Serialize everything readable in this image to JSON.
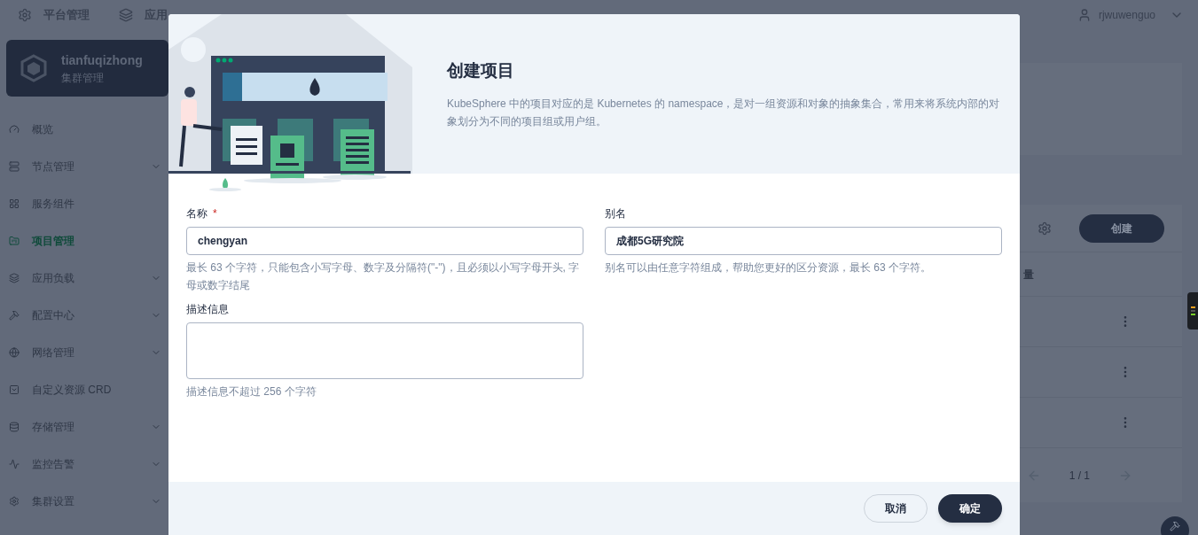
{
  "top_nav": {
    "items": [
      {
        "label": "平台管理"
      },
      {
        "label": "应用"
      }
    ],
    "user": "rjwuwenguo"
  },
  "cluster": {
    "name": "tianfuqizhong",
    "subtitle": "集群管理"
  },
  "sidebar": {
    "items": [
      {
        "label": "概览",
        "expandable": false,
        "selected": false
      },
      {
        "label": "节点管理",
        "expandable": true,
        "selected": false
      },
      {
        "label": "服务组件",
        "expandable": false,
        "selected": false
      },
      {
        "label": "项目管理",
        "expandable": false,
        "selected": true
      },
      {
        "label": "应用负载",
        "expandable": true,
        "selected": false
      },
      {
        "label": "配置中心",
        "expandable": true,
        "selected": false
      },
      {
        "label": "网络管理",
        "expandable": true,
        "selected": false
      },
      {
        "label": "自定义资源 CRD",
        "expandable": false,
        "selected": false
      },
      {
        "label": "存储管理",
        "expandable": true,
        "selected": false
      },
      {
        "label": "监控告警",
        "expandable": true,
        "selected": false
      },
      {
        "label": "集群设置",
        "expandable": true,
        "selected": false
      }
    ]
  },
  "background_table": {
    "create_button": "创建",
    "column_header": "量",
    "pagination": "1 / 1"
  },
  "dialog": {
    "title": "创建项目",
    "description": "KubeSphere 中的项目对应的是 Kubernetes 的 namespace，是对一组资源和对象的抽象集合，常用来将系统内部的对象划分为不同的项目组或用户组。",
    "fields": [
      {
        "label": "名称",
        "required_mark": "*",
        "value": "chengyan",
        "hint": "最长 63 个字符，只能包含小写字母、数字及分隔符(\"-\")，且必须以小写字母开头, 字母或数字结尾",
        "kind": "input"
      },
      {
        "label": "别名",
        "value": "成都5G研究院",
        "hint": "别名可以由任意字符组成，帮助您更好的区分资源，最长 63 个字符。",
        "kind": "input"
      },
      {
        "label": "描述信息",
        "hint": "描述信息不超过 256 个字符",
        "kind": "textarea"
      }
    ],
    "buttons": [
      {
        "label": "取消",
        "kind": "secondary"
      },
      {
        "label": "确定",
        "kind": "primary"
      }
    ]
  }
}
